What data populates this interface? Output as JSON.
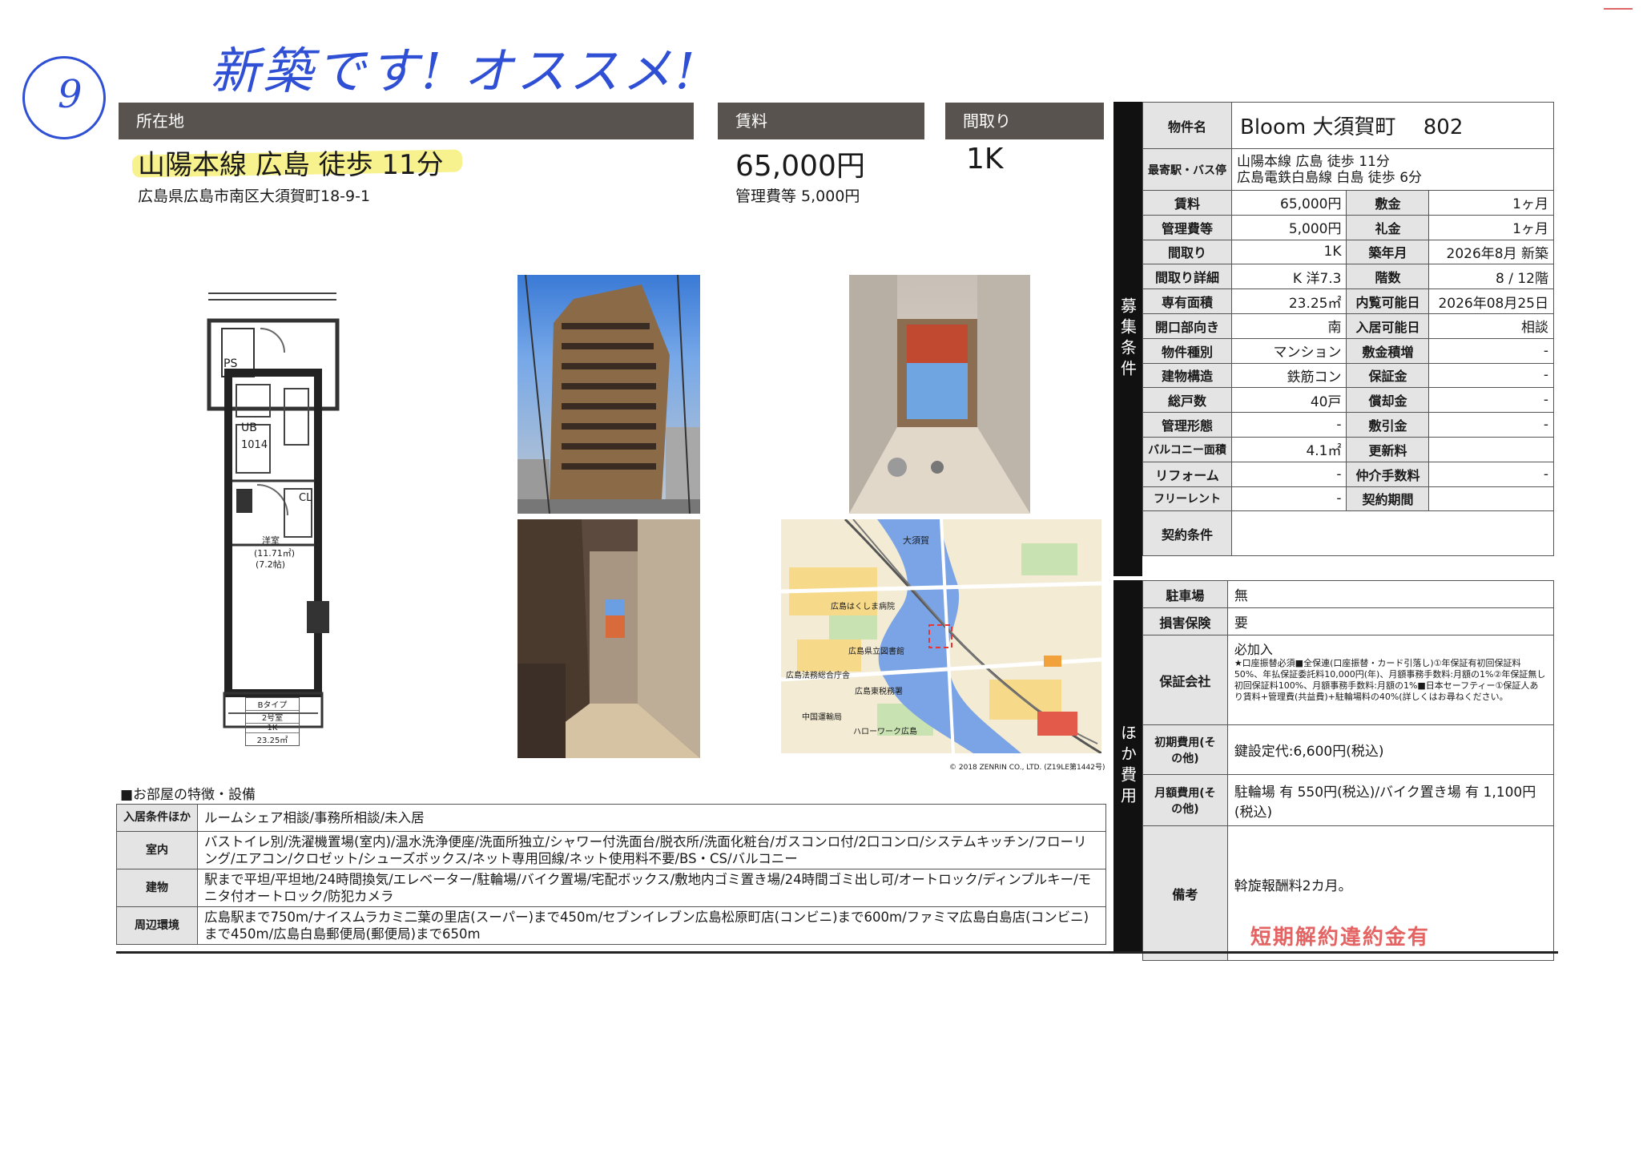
{
  "handwritten": {
    "number": "9",
    "note": "新築です! オススメ!"
  },
  "location": {
    "header": "所在地",
    "route": "山陽本線 広島 徒歩 11分",
    "address": "広島県広島市南区大須賀町18-9-1"
  },
  "rent": {
    "header": "賃料",
    "amount": "65,000円",
    "fee": "管理費等 5,000円"
  },
  "layout": {
    "header": "間取り",
    "value": "1K"
  },
  "floorplan": {
    "ps": "PS",
    "ub": "UB",
    "ub_size": "1014",
    "cl": "CL",
    "room_name": "洋室",
    "room_area_m": "(11.71㎡)",
    "room_area_j": "(7.2帖)",
    "type_box": [
      "Bタイプ",
      "2号室",
      "1K",
      "23.25㎡"
    ]
  },
  "map": {
    "labels": [
      "大須賀",
      "広島はくしま病院",
      "広島県立図書館",
      "広島法務総合庁舎",
      "広島東税務署",
      "ハローワーク広島",
      "中国運輸局"
    ],
    "copyright": "© 2018 ZENRIN CO., LTD. (Z19LE第1442号)"
  },
  "property": {
    "name_label": "物件名",
    "name": "Bloom 大須賀町　 802",
    "station_label": "最寄駅・バス停",
    "station_lines": [
      "山陽本線 広島 徒歩 11分",
      "広島電鉄白島線 白島 徒歩 6分"
    ],
    "rows": [
      [
        "賃料",
        "65,000円",
        "敷金",
        "1ヶ月"
      ],
      [
        "管理費等",
        "5,000円",
        "礼金",
        "1ヶ月"
      ],
      [
        "間取り",
        "1K",
        "築年月",
        "2026年8月 新築"
      ],
      [
        "間取り詳細",
        "K 洋7.3",
        "階数",
        "8 / 12階"
      ],
      [
        "専有面積",
        "23.25㎡",
        "内覧可能日",
        "2026年08月25日"
      ],
      [
        "開口部向き",
        "南",
        "入居可能日",
        "相談"
      ],
      [
        "物件種別",
        "マンション",
        "敷金積増",
        "-"
      ],
      [
        "建物構造",
        "鉄筋コン",
        "保証金",
        "-"
      ],
      [
        "総戸数",
        "40戸",
        "償却金",
        "-"
      ],
      [
        "管理形態",
        "-",
        "敷引金",
        "-"
      ],
      [
        "バルコニー面積",
        "4.1㎡",
        "更新料",
        ""
      ],
      [
        "リフォーム",
        "-",
        "仲介手数料",
        "-"
      ],
      [
        "フリーレント",
        "-",
        "契約期間",
        ""
      ]
    ],
    "contract_label": "契約条件",
    "contract_value": ""
  },
  "side_labels": {
    "conditions": "募集条件",
    "other_costs": "ほか費用"
  },
  "costs": {
    "parking_label": "駐車場",
    "parking": "無",
    "insurance_label": "損害保険",
    "insurance": "要",
    "guarantee_label": "保証会社",
    "guarantee_head": "必加入",
    "guarantee_detail": "★口座振替必須■全保連(口座振替・カード引落し)①年保証有初回保証料50%、年払保証委託料10,000円(年)、月額事務手数料:月額の1%②年保証無し初回保証料100%、月額事務手数料:月額の1%■日本セーフティー①保証人あり賃料+管理費(共益費)+駐輪場料の40%(詳しくはお尋ねください。",
    "initial_label": "初期費用(その他)",
    "initial": "鍵設定代:6,600円(税込)",
    "monthly_label": "月額費用(その他)",
    "monthly": "駐輪場 有 550円(税込)/バイク置き場 有 1,100円(税込)",
    "remarks_label": "備考",
    "remarks": "斡旋報酬料2カ月。",
    "stamp": "短期解約違約金有"
  },
  "features": {
    "title": "■お部屋の特徴・設備",
    "rows": [
      {
        "label": "入居条件ほか",
        "text": "ルームシェア相談/事務所相談/未入居"
      },
      {
        "label": "室内",
        "text": "バストイレ別/洗濯機置場(室内)/温水洗浄便座/洗面所独立/シャワー付洗面台/脱衣所/洗面化粧台/ガスコンロ付/2口コンロ/システムキッチン/フローリング/エアコン/クロゼット/シューズボックス/ネット専用回線/ネット使用料不要/BS・CS/バルコニー"
      },
      {
        "label": "建物",
        "text": "駅まで平坦/平坦地/24時間換気/エレベーター/駐輪場/バイク置場/宅配ボックス/敷地内ゴミ置き場/24時間ゴミ出し可/オートロック/ディンプルキー/モニタ付オートロック/防犯カメラ"
      },
      {
        "label": "周辺環境",
        "text": "広島駅まで750m/ナイスムラカミ二葉の里店(スーパー)まで450m/セブンイレブン広島松原町店(コンビニ)まで600m/ファミマ広島白島店(コンビニ)まで450m/広島白島郵便局(郵便局)まで650m"
      }
    ]
  }
}
